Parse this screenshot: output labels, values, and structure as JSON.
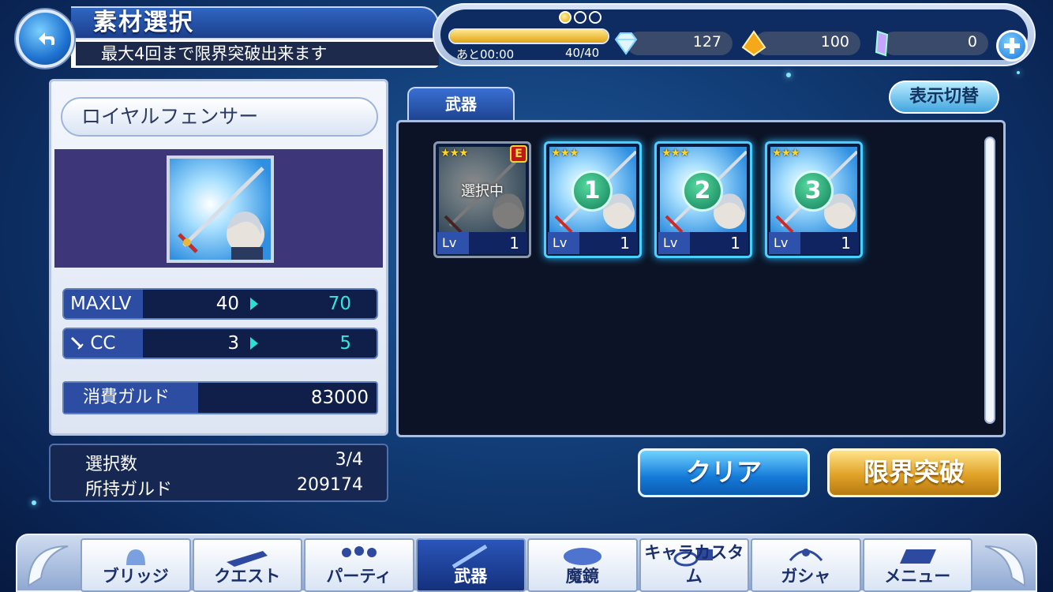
{
  "header": {
    "title": "素材選択",
    "subtitle": "最大4回まで限界突破出来ます"
  },
  "stamina": {
    "orbs_filled": 1,
    "orbs_total": 3,
    "timer": "あと00:00",
    "count": "40/40",
    "fill_ratio": 1.0
  },
  "currency": {
    "gems": "127",
    "crystals": "100",
    "tickets": "0"
  },
  "weapon": {
    "name": "ロイヤルフェンサー",
    "stats": [
      {
        "label": "MAXLV",
        "from": "40",
        "to": "70"
      },
      {
        "label": "CC",
        "from": "3",
        "to": "5"
      }
    ],
    "cost_label": "消費ガルド",
    "cost_value": "83000"
  },
  "summary": {
    "selected_label": "選択数",
    "selected_value": "3/4",
    "owned_label": "所持ガルド",
    "owned_value": "209174"
  },
  "materials": {
    "tab_label": "武器",
    "toggle_label": "表示切替",
    "cards": [
      {
        "stars": "★★★",
        "overlay": "選択中",
        "lv_label": "Lv",
        "lv": "1",
        "badge": "E"
      },
      {
        "stars": "★★★",
        "number": "1",
        "lv_label": "Lv",
        "lv": "1"
      },
      {
        "stars": "★★★",
        "number": "2",
        "lv_label": "Lv",
        "lv": "1"
      },
      {
        "stars": "★★★",
        "number": "3",
        "lv_label": "Lv",
        "lv": "1"
      }
    ]
  },
  "actions": {
    "clear": "クリア",
    "limit_break": "限界突破"
  },
  "nav": {
    "items": [
      {
        "label": "ブリッジ",
        "icon": "bridge-icon"
      },
      {
        "label": "クエスト",
        "icon": "quest-icon"
      },
      {
        "label": "パーティ",
        "icon": "party-icon"
      },
      {
        "label": "武器",
        "icon": "weapon-icon"
      },
      {
        "label": "魔鏡",
        "icon": "mirror-icon"
      },
      {
        "label": "キャラカスタム",
        "icon": "chara-custom-icon"
      },
      {
        "label": "ガシャ",
        "icon": "gacha-icon"
      },
      {
        "label": "メニュー",
        "icon": "menu-icon"
      }
    ]
  }
}
